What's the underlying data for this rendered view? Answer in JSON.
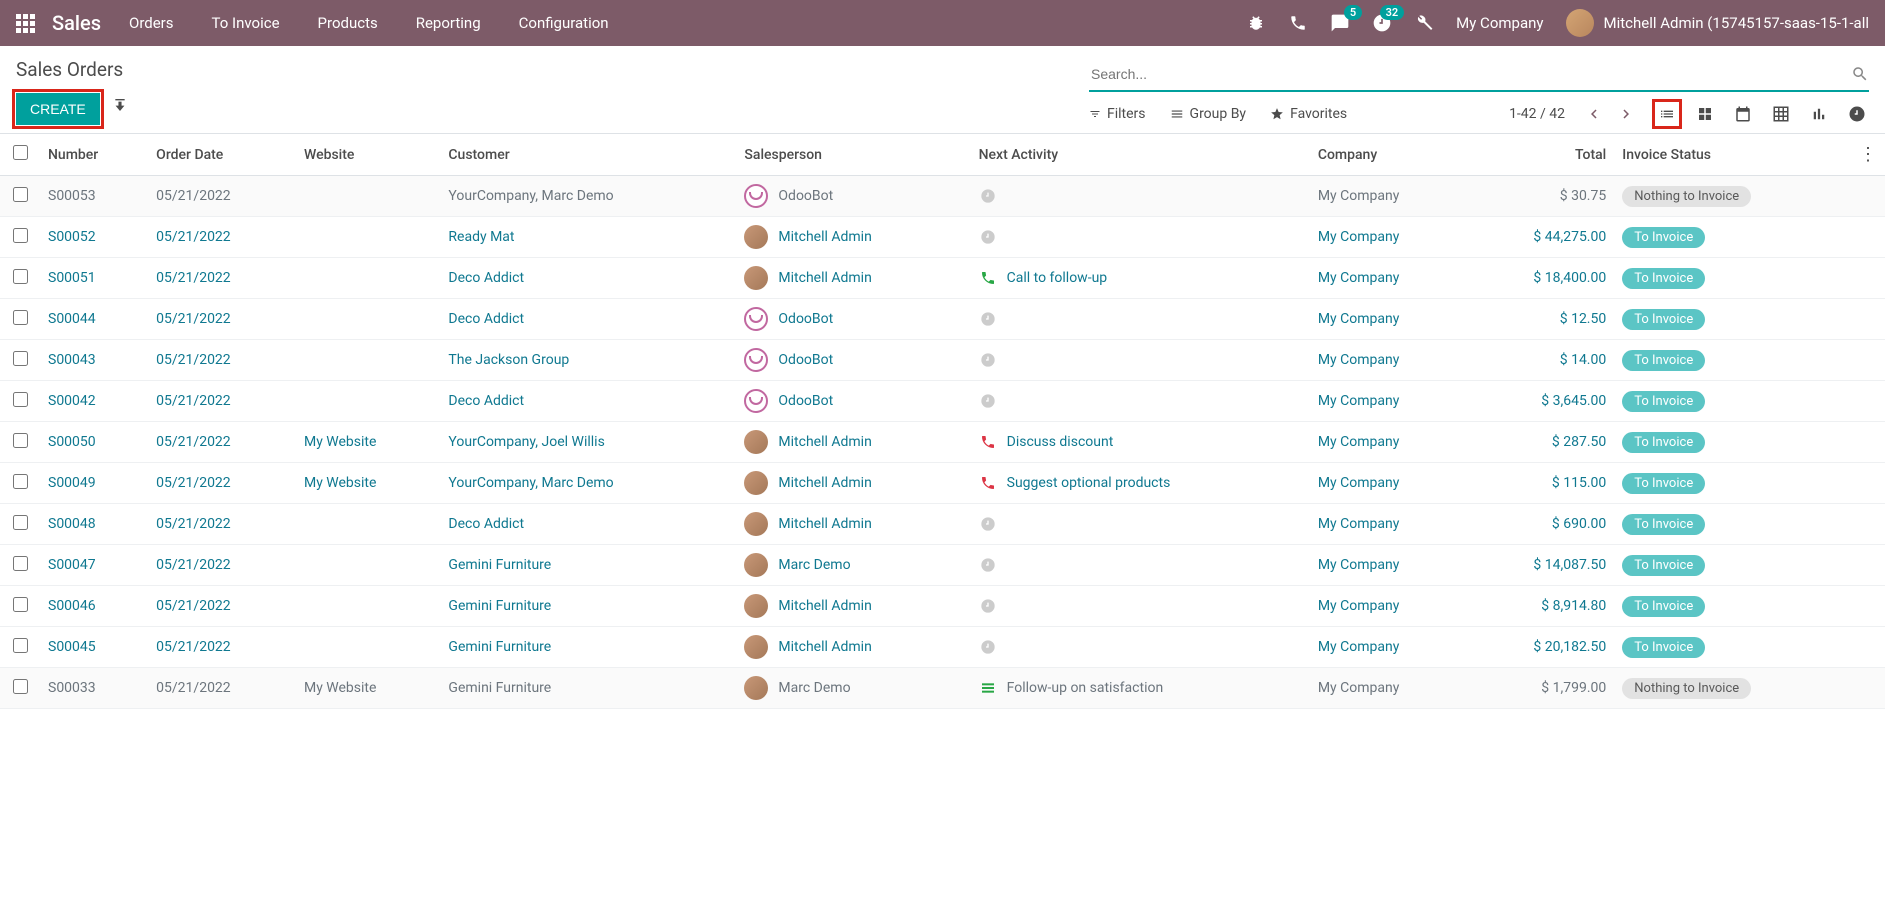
{
  "nav": {
    "brand": "Sales",
    "links": [
      "Orders",
      "To Invoice",
      "Products",
      "Reporting",
      "Configuration"
    ],
    "msg_badge": "5",
    "activity_badge": "32",
    "company": "My Company",
    "user": "Mitchell Admin (15745157-saas-15-1-all"
  },
  "breadcrumb": "Sales Orders",
  "create_label": "CREATE",
  "search_placeholder": "Search...",
  "filters_label": "Filters",
  "groupby_label": "Group By",
  "favorites_label": "Favorites",
  "pager": "1-42 / 42",
  "columns": {
    "number": "Number",
    "order_date": "Order Date",
    "website": "Website",
    "customer": "Customer",
    "salesperson": "Salesperson",
    "next_activity": "Next Activity",
    "company": "Company",
    "total": "Total",
    "invoice_status": "Invoice Status"
  },
  "rows": [
    {
      "number": "S00053",
      "date": "05/21/2022",
      "website": "",
      "customer": "YourCompany, Marc Demo",
      "sp": "OdooBot",
      "sp_type": "bot",
      "activity": "",
      "act_type": "clock",
      "company": "My Company",
      "total": "$ 30.75",
      "status": "Nothing to Invoice",
      "status_class": "badge-nothing",
      "style": "muted"
    },
    {
      "number": "S00052",
      "date": "05/21/2022",
      "website": "",
      "customer": "Ready Mat",
      "sp": "Mitchell Admin",
      "sp_type": "user",
      "activity": "",
      "act_type": "clock",
      "company": "My Company",
      "total": "$ 44,275.00",
      "status": "To Invoice",
      "status_class": "badge-toinv",
      "style": "link"
    },
    {
      "number": "S00051",
      "date": "05/21/2022",
      "website": "",
      "customer": "Deco Addict",
      "sp": "Mitchell Admin",
      "sp_type": "user",
      "activity": "Call to follow-up",
      "act_type": "phone-green",
      "company": "My Company",
      "total": "$ 18,400.00",
      "status": "To Invoice",
      "status_class": "badge-toinv",
      "style": "link"
    },
    {
      "number": "S00044",
      "date": "05/21/2022",
      "website": "",
      "customer": "Deco Addict",
      "sp": "OdooBot",
      "sp_type": "bot",
      "activity": "",
      "act_type": "clock",
      "company": "My Company",
      "total": "$ 12.50",
      "status": "To Invoice",
      "status_class": "badge-toinv",
      "style": "link"
    },
    {
      "number": "S00043",
      "date": "05/21/2022",
      "website": "",
      "customer": "The Jackson Group",
      "sp": "OdooBot",
      "sp_type": "bot",
      "activity": "",
      "act_type": "clock",
      "company": "My Company",
      "total": "$ 14.00",
      "status": "To Invoice",
      "status_class": "badge-toinv",
      "style": "link"
    },
    {
      "number": "S00042",
      "date": "05/21/2022",
      "website": "",
      "customer": "Deco Addict",
      "sp": "OdooBot",
      "sp_type": "bot",
      "activity": "",
      "act_type": "clock",
      "company": "My Company",
      "total": "$ 3,645.00",
      "status": "To Invoice",
      "status_class": "badge-toinv",
      "style": "link"
    },
    {
      "number": "S00050",
      "date": "05/21/2022",
      "website": "My Website",
      "customer": "YourCompany, Joel Willis",
      "sp": "Mitchell Admin",
      "sp_type": "user",
      "activity": "Discuss discount",
      "act_type": "phone-red",
      "company": "My Company",
      "total": "$ 287.50",
      "status": "To Invoice",
      "status_class": "badge-toinv",
      "style": "link"
    },
    {
      "number": "S00049",
      "date": "05/21/2022",
      "website": "My Website",
      "customer": "YourCompany, Marc Demo",
      "sp": "Mitchell Admin",
      "sp_type": "user",
      "activity": "Suggest optional products",
      "act_type": "phone-red",
      "company": "My Company",
      "total": "$ 115.00",
      "status": "To Invoice",
      "status_class": "badge-toinv",
      "style": "link"
    },
    {
      "number": "S00048",
      "date": "05/21/2022",
      "website": "",
      "customer": "Deco Addict",
      "sp": "Mitchell Admin",
      "sp_type": "user",
      "activity": "",
      "act_type": "clock",
      "company": "My Company",
      "total": "$ 690.00",
      "status": "To Invoice",
      "status_class": "badge-toinv",
      "style": "link"
    },
    {
      "number": "S00047",
      "date": "05/21/2022",
      "website": "",
      "customer": "Gemini Furniture",
      "sp": "Marc Demo",
      "sp_type": "user",
      "activity": "",
      "act_type": "clock",
      "company": "My Company",
      "total": "$ 14,087.50",
      "status": "To Invoice",
      "status_class": "badge-toinv",
      "style": "link"
    },
    {
      "number": "S00046",
      "date": "05/21/2022",
      "website": "",
      "customer": "Gemini Furniture",
      "sp": "Mitchell Admin",
      "sp_type": "user",
      "activity": "",
      "act_type": "clock",
      "company": "My Company",
      "total": "$ 8,914.80",
      "status": "To Invoice",
      "status_class": "badge-toinv",
      "style": "link"
    },
    {
      "number": "S00045",
      "date": "05/21/2022",
      "website": "",
      "customer": "Gemini Furniture",
      "sp": "Mitchell Admin",
      "sp_type": "user",
      "activity": "",
      "act_type": "clock",
      "company": "My Company",
      "total": "$ 20,182.50",
      "status": "To Invoice",
      "status_class": "badge-toinv",
      "style": "link"
    },
    {
      "number": "S00033",
      "date": "05/21/2022",
      "website": "My Website",
      "customer": "Gemini Furniture",
      "sp": "Marc Demo",
      "sp_type": "user",
      "activity": "Follow-up on satisfaction",
      "act_type": "bars",
      "company": "My Company",
      "total": "$ 1,799.00",
      "status": "Nothing to Invoice",
      "status_class": "badge-nothing",
      "style": "muted"
    }
  ]
}
